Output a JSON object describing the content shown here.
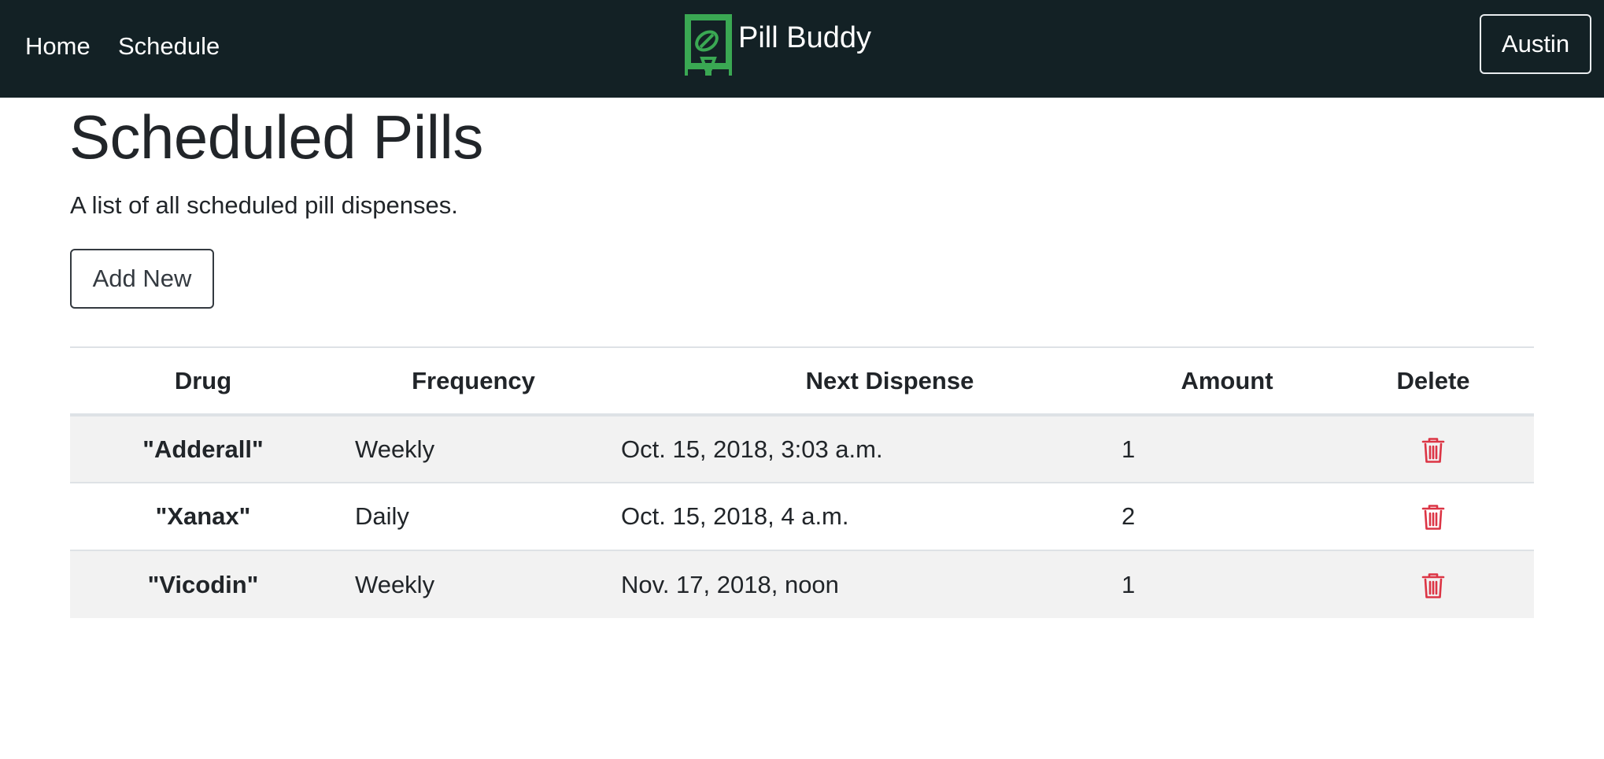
{
  "nav": {
    "home_label": "Home",
    "schedule_label": "Schedule",
    "brand_name": "Pill Buddy",
    "brand_logo_icon": "pill-dispenser-icon",
    "user_label": "Austin"
  },
  "page": {
    "title": "Scheduled Pills",
    "subtitle": "A list of all scheduled pill dispenses.",
    "add_label": "Add New"
  },
  "table": {
    "headers": [
      "Drug",
      "Frequency",
      "Next Dispense",
      "Amount",
      "Delete"
    ],
    "rows": [
      {
        "drug": "\"Adderall\"",
        "frequency": "Weekly",
        "next_dispense": "Oct. 15, 2018, 3:03 a.m.",
        "amount": "1",
        "delete_icon": "trash-icon"
      },
      {
        "drug": "\"Xanax\"",
        "frequency": "Daily",
        "next_dispense": "Oct. 15, 2018, 4 a.m.",
        "amount": "2",
        "delete_icon": "trash-icon"
      },
      {
        "drug": "\"Vicodin\"",
        "frequency": "Weekly",
        "next_dispense": "Nov. 17, 2018, noon",
        "amount": "1",
        "delete_icon": "trash-icon"
      }
    ]
  },
  "colors": {
    "navbar_bg": "#132125",
    "brand_green": "#3aa853",
    "delete_red": "#dc3545",
    "stripe_bg": "#f2f2f2"
  }
}
